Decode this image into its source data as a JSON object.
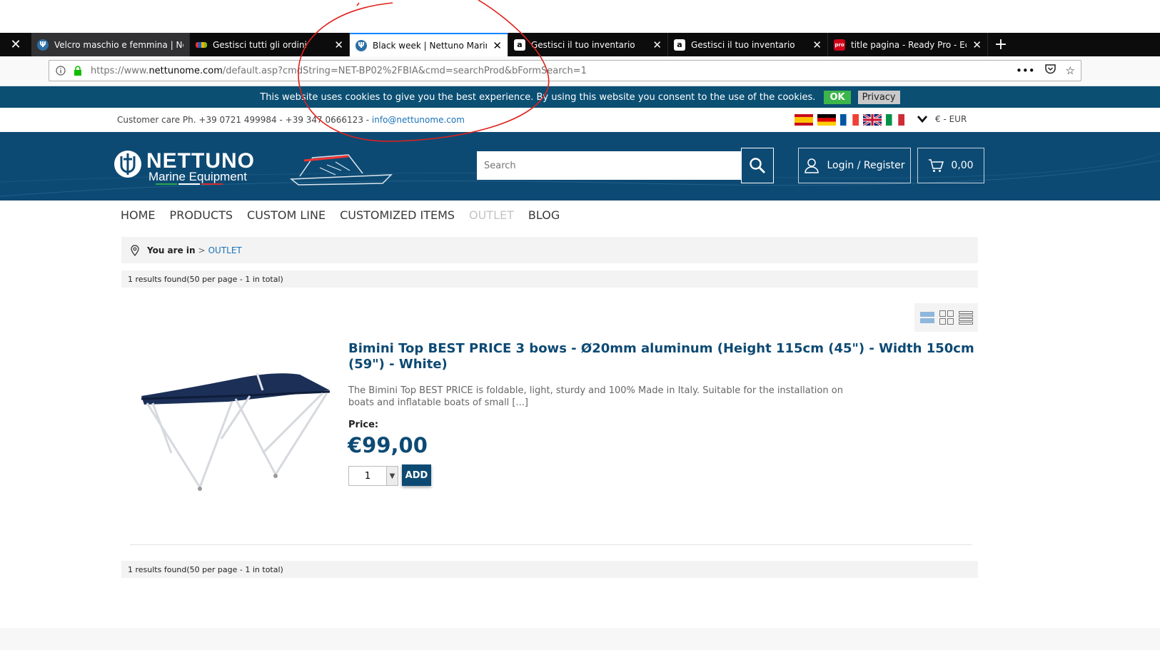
{
  "browser": {
    "tabs": [
      {
        "title": "Velcro maschio e femmina | Ne",
        "icon": "nettuno-favicon",
        "state": "hover"
      },
      {
        "title": "Gestisci tutti gli ordini",
        "icon": "ebay-favicon",
        "state": "normal"
      },
      {
        "title": "Black week | Nettuno Marine Ec",
        "icon": "nettuno-favicon",
        "state": "active"
      },
      {
        "title": "Gestisci il tuo inventario",
        "icon": "amazon-favicon",
        "state": "normal"
      },
      {
        "title": "Gestisci il tuo inventario",
        "icon": "amazon-favicon",
        "state": "normal"
      },
      {
        "title": "title pagina - Ready Pro - Ecom",
        "icon": "readypro-favicon",
        "state": "normal"
      }
    ],
    "url_prefix": "https://www.",
    "url_domain": "nettunome.com",
    "url_path": "/default.asp?cmdString=NET-BP02%2FBIA&cmd=searchProd&bFormSearch=1"
  },
  "cookie_banner": {
    "text": "This website uses cookies to give you the best experience. By using this website you consent to the use of the cookies.",
    "ok_label": "OK",
    "privacy_label": "Privacy"
  },
  "topbar": {
    "contact_text": "Customer care Ph. +39 0721 499984 - +39 347 0666123 - ",
    "email": "info@nettunome.com",
    "currency": "€ - EUR",
    "flags": [
      "es",
      "de",
      "fr",
      "gb",
      "it"
    ]
  },
  "header": {
    "logo_title": "NETTUNO",
    "logo_subtitle": "Marine Equipment",
    "search_placeholder": "Search",
    "login_label": "Login / Register",
    "cart_total": "0,00"
  },
  "menu": [
    "HOME",
    "PRODUCTS",
    "CUSTOM LINE",
    "CUSTOMIZED ITEMS",
    "OUTLET",
    "BLOG"
  ],
  "breadcrumb": {
    "prefix": "You are in",
    "separator": ">",
    "current": "OUTLET"
  },
  "results_text": "1 results found(50 per page - 1 in total)",
  "product": {
    "title": "Bimini Top BEST PRICE 3 bows - Ø20mm aluminum (Height 115cm (45\") - Width 150cm (59\") - White)",
    "description": "The Bimini Top BEST PRICE is foldable, light, sturdy and 100% Made in Italy. Suitable for the installation on boats and inflatable boats of small [...]",
    "price_label": "Price:",
    "price": "€99,00",
    "quantity": "1",
    "add_label": "ADD"
  },
  "colors": {
    "brand_blue": "#0d4a73",
    "cookie_bg": "#0b4f73",
    "ok_green": "#3cb54a",
    "link_blue": "#1a72b8",
    "annotation_red": "#e0201b"
  }
}
